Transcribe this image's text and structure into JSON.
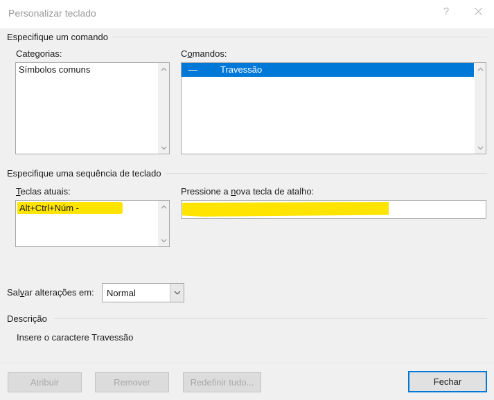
{
  "window": {
    "title": "Personalizar teclado",
    "help_icon": "question-mark-icon",
    "close_icon": "close-icon"
  },
  "groups": {
    "command": {
      "label": "Especifique um comando"
    },
    "keyboard_sequence": {
      "label": "Especifique uma sequência de teclado"
    },
    "description": {
      "label": "Descrição"
    }
  },
  "categories": {
    "label": "Categorias:",
    "items": [
      "Símbolos comuns"
    ],
    "selected_index": -1,
    "scroll_up_icon": "chevron-up-icon",
    "scroll_down_icon": "chevron-down-icon"
  },
  "commands": {
    "label_prefix": "C",
    "label_accel": "o",
    "label_suffix": "mandos:",
    "items": [
      {
        "glyph": "—",
        "name": "Travessão",
        "selected": true
      }
    ],
    "selected_color": "#0078d7",
    "scroll_up_icon": "chevron-up-icon",
    "scroll_down_icon": "chevron-down-icon"
  },
  "current_keys": {
    "label_prefix": "",
    "label_accel": "T",
    "label_suffix": "eclas atuais:",
    "value": "Alt+Ctrl+Núm -",
    "highlight_color": "#ffe400",
    "scroll_up_icon": "chevron-up-icon",
    "scroll_down_icon": "chevron-down-icon"
  },
  "new_shortcut": {
    "label_prefix": "Pressione a ",
    "label_accel": "n",
    "label_suffix": "ova tecla de atalho:",
    "value": "",
    "placeholder": "",
    "highlight_color": "#ffe400"
  },
  "save_changes": {
    "label_prefix": "Sal",
    "label_accel": "v",
    "label_suffix": "ar alterações em:",
    "selected": "Normal",
    "options": [
      "Normal"
    ],
    "arrow_icon": "chevron-down-icon"
  },
  "description": {
    "text": "Insere o caractere Travessão"
  },
  "footer": {
    "assign": {
      "label": "Atribuir",
      "enabled": false
    },
    "remove": {
      "label": "Remover",
      "enabled": false
    },
    "reset_all": {
      "label": "Redefinir tudo...",
      "enabled": false
    },
    "close": {
      "label": "Fechar",
      "enabled": true,
      "is_default": true,
      "focus_color": "#0078d7"
    }
  }
}
